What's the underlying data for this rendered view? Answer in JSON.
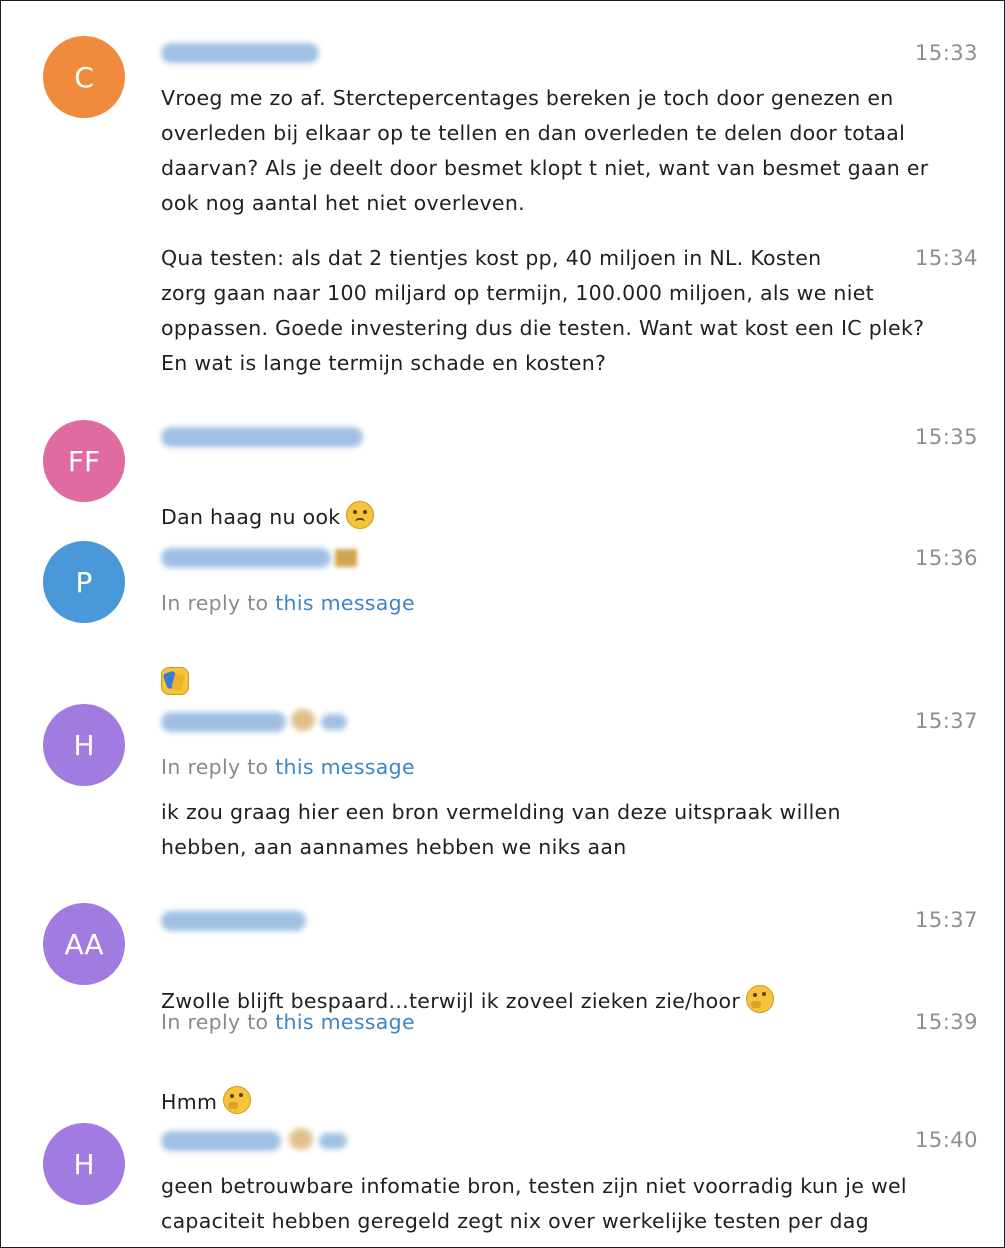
{
  "messages": [
    {
      "avatar_initials": "C",
      "avatar_color": "#f08a3c",
      "time": "15:33",
      "text": "Vroeg me zo af. Sterctepercentages bereken je toch door genezen en\noverleden bij elkaar op te tellen en dan overleden te delen door totaal\ndaarvan? Als je deelt door besmet klopt t niet, want van besmet gaan er\nook nog aantal het niet overleven."
    },
    {
      "time": "15:34",
      "text": "Qua testen: als dat 2 tientjes kost pp, 40 miljoen in NL. Kosten\nzorg gaan naar 100 miljard op termijn, 100.000 miljoen, als we niet\noppassen. Goede investering dus die testen. Want wat kost een IC plek?\nEn wat is lange termijn schade en kosten?"
    },
    {
      "avatar_initials": "FF",
      "avatar_color": "#df6ba0",
      "time": "15:35",
      "text": "Dan haag nu ook",
      "emoji": "sad-face-emoji"
    },
    {
      "avatar_initials": "P",
      "avatar_color": "#4a97da",
      "time": "15:36",
      "reply_prefix": "In reply to",
      "reply_link": "this message",
      "emoji": "praying-emoji"
    },
    {
      "avatar_initials": "H",
      "avatar_color": "#a27be0",
      "time": "15:37",
      "reply_prefix": "In reply to",
      "reply_link": "this message",
      "text": "ik zou graag hier een bron vermelding van deze uitspraak willen\nhebben, aan aannames hebben we niks aan"
    },
    {
      "avatar_initials": "AA",
      "avatar_color": "#a27be0",
      "time": "15:37",
      "text": "Zwolle blijft bespaard...terwijl ik zoveel zieken zie/hoor",
      "emoji": "thinking-face-emoji"
    },
    {
      "time": "15:39",
      "reply_prefix": "In reply to",
      "reply_link": "this message",
      "text": "Hmm",
      "emoji": "thinking-face-emoji"
    },
    {
      "avatar_initials": "H",
      "avatar_color": "#a27be0",
      "time": "15:40",
      "text": "geen betrouwbare infomatie bron, testen zijn niet voorradig kun je wel\ncapaciteit hebben geregeld zegt nix over werkelijke testen per dag"
    }
  ],
  "colors": {
    "sender_blur": "#8fb6de",
    "link": "#3d86c6",
    "timestamp": "#8e8e8e"
  }
}
